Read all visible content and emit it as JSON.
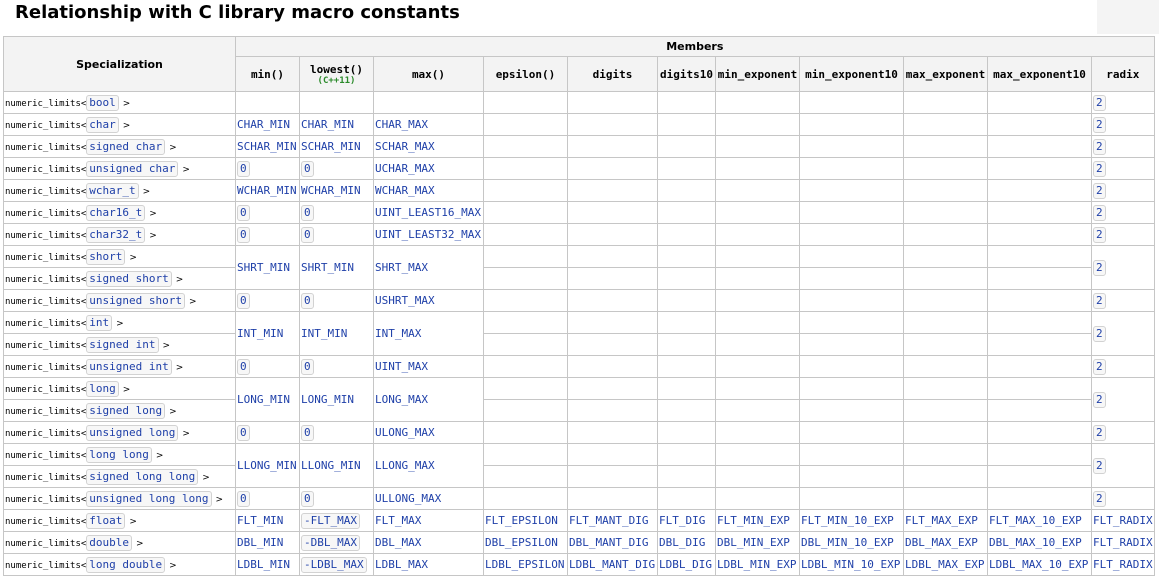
{
  "title": "Relationship with C library macro constants",
  "header": {
    "members": "Members",
    "specialization": "Specialization",
    "min": "min()",
    "lowest": "lowest()",
    "lowest_note": "(C++11)",
    "max": "max()",
    "epsilon": "epsilon()",
    "digits": "digits",
    "digits10": "digits10",
    "min_exponent": "min_exponent",
    "min_exponent10": "min_exponent10",
    "max_exponent": "max_exponent",
    "max_exponent10": "max_exponent10",
    "radix": "radix"
  },
  "spec_prefix": "numeric_limits<",
  "spec_suffix": ">",
  "types": [
    "bool",
    "char",
    "signed char",
    "unsigned char",
    "wchar_t",
    "char16_t",
    "char32_t",
    "short",
    "signed short",
    "unsigned short",
    "int",
    "signed int",
    "unsigned int",
    "long",
    "signed long",
    "unsigned long",
    "long long",
    "signed long long",
    "unsigned long long",
    "float",
    "double",
    "long double"
  ],
  "cells": {
    "char_min": "CHAR_MIN",
    "char_max": "CHAR_MAX",
    "schar_min": "SCHAR_MIN",
    "schar_max": "SCHAR_MAX",
    "zero": "0",
    "uchar_max": "UCHAR_MAX",
    "wchar_min": "WCHAR_MIN",
    "wchar_max": "WCHAR_MAX",
    "u16_max": "UINT_LEAST16_MAX",
    "u32_max": "UINT_LEAST32_MAX",
    "shrt_min": "SHRT_MIN",
    "shrt_max": "SHRT_MAX",
    "ushrt_max": "USHRT_MAX",
    "int_min": "INT_MIN",
    "int_max": "INT_MAX",
    "uint_max": "UINT_MAX",
    "long_min": "LONG_MIN",
    "long_max": "LONG_MAX",
    "ulong_max": "ULONG_MAX",
    "llong_min": "LLONG_MIN",
    "llong_max": "LLONG_MAX",
    "ullong_max": "ULLONG_MAX",
    "radix2": "2"
  },
  "float_rows": {
    "float": [
      "FLT_MIN",
      "-FLT_MAX",
      "FLT_MAX",
      "FLT_EPSILON",
      "FLT_MANT_DIG",
      "FLT_DIG",
      "FLT_MIN_EXP",
      "FLT_MIN_10_EXP",
      "FLT_MAX_EXP",
      "FLT_MAX_10_EXP",
      "FLT_RADIX"
    ],
    "double": [
      "DBL_MIN",
      "-DBL_MAX",
      "DBL_MAX",
      "DBL_EPSILON",
      "DBL_MANT_DIG",
      "DBL_DIG",
      "DBL_MIN_EXP",
      "DBL_MIN_10_EXP",
      "DBL_MAX_EXP",
      "DBL_MAX_10_EXP",
      "FLT_RADIX"
    ],
    "long_double": [
      "LDBL_MIN",
      "-LDBL_MAX",
      "LDBL_MAX",
      "LDBL_EPSILON",
      "LDBL_MANT_DIG",
      "LDBL_DIG",
      "LDBL_MIN_EXP",
      "LDBL_MIN_10_EXP",
      "LDBL_MAX_EXP",
      "LDBL_MAX_10_EXP",
      "FLT_RADIX"
    ]
  }
}
